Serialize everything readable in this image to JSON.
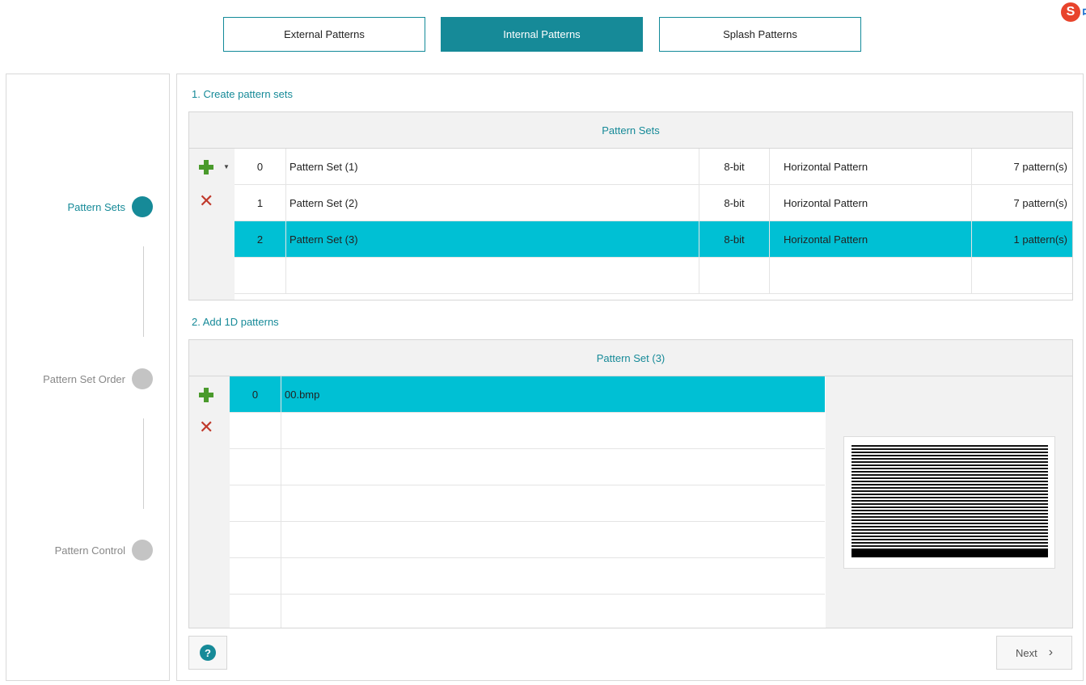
{
  "tabs": [
    {
      "label": "External Patterns",
      "active": false
    },
    {
      "label": "Internal Patterns",
      "active": true
    },
    {
      "label": "Splash Patterns",
      "active": false
    }
  ],
  "ime": {
    "icon": "sogou-s-icon",
    "label": "中"
  },
  "steps": [
    {
      "label": "Pattern Sets",
      "active": true
    },
    {
      "label": "Pattern Set Order",
      "active": false
    },
    {
      "label": "Pattern Control",
      "active": false
    }
  ],
  "section1": {
    "title": "1. Create pattern sets",
    "grid_header": "Pattern Sets",
    "rows": [
      {
        "index": "0",
        "name": "Pattern Set (1)",
        "bits": "8-bit",
        "type": "Horizontal Pattern",
        "count": "7 pattern(s)",
        "selected": false
      },
      {
        "index": "1",
        "name": "Pattern Set (2)",
        "bits": "8-bit",
        "type": "Horizontal Pattern",
        "count": "7 pattern(s)",
        "selected": false
      },
      {
        "index": "2",
        "name": "Pattern Set (3)",
        "bits": "8-bit",
        "type": "Horizontal Pattern",
        "count": "1 pattern(s)",
        "selected": true
      }
    ]
  },
  "section2": {
    "title": "2. Add 1D patterns",
    "grid_header": "Pattern Set (3)",
    "rows": [
      {
        "index": "0",
        "name": "00.bmp",
        "selected": true
      }
    ]
  },
  "buttons": {
    "help": "?",
    "next": "Next",
    "next_icon": "›"
  },
  "colors": {
    "accent": "#168a98",
    "selection": "#00c0d4",
    "add": "#4a9a2c",
    "delete": "#c0392b"
  }
}
